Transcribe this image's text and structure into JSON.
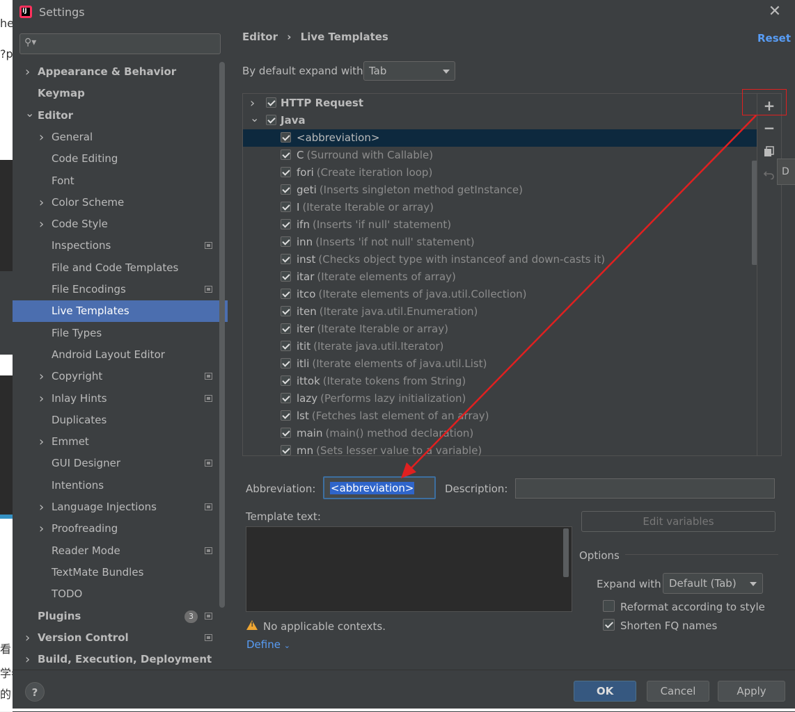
{
  "window": {
    "title": "Settings"
  },
  "background_fragments": [
    "he",
    "?p",
    "看",
    "学者",
    "的"
  ],
  "sidebar": {
    "search_placeholder": "",
    "items": [
      {
        "label": "Appearance & Behavior",
        "level": 0,
        "bold": true,
        "arrow": "right",
        "page_icon": false
      },
      {
        "label": "Keymap",
        "level": 0,
        "bold": true,
        "arrow": "none",
        "page_icon": false
      },
      {
        "label": "Editor",
        "level": 0,
        "bold": true,
        "arrow": "down",
        "page_icon": false
      },
      {
        "label": "General",
        "level": 1,
        "bold": false,
        "arrow": "right",
        "page_icon": false
      },
      {
        "label": "Code Editing",
        "level": 1,
        "bold": false,
        "arrow": "none",
        "page_icon": false
      },
      {
        "label": "Font",
        "level": 1,
        "bold": false,
        "arrow": "none",
        "page_icon": false
      },
      {
        "label": "Color Scheme",
        "level": 1,
        "bold": false,
        "arrow": "right",
        "page_icon": false
      },
      {
        "label": "Code Style",
        "level": 1,
        "bold": false,
        "arrow": "right",
        "page_icon": false
      },
      {
        "label": "Inspections",
        "level": 1,
        "bold": false,
        "arrow": "none",
        "page_icon": true
      },
      {
        "label": "File and Code Templates",
        "level": 1,
        "bold": false,
        "arrow": "none",
        "page_icon": false
      },
      {
        "label": "File Encodings",
        "level": 1,
        "bold": false,
        "arrow": "none",
        "page_icon": true
      },
      {
        "label": "Live Templates",
        "level": 1,
        "bold": false,
        "arrow": "none",
        "page_icon": false,
        "selected": true
      },
      {
        "label": "File Types",
        "level": 1,
        "bold": false,
        "arrow": "none",
        "page_icon": false
      },
      {
        "label": "Android Layout Editor",
        "level": 1,
        "bold": false,
        "arrow": "none",
        "page_icon": false
      },
      {
        "label": "Copyright",
        "level": 1,
        "bold": false,
        "arrow": "right",
        "page_icon": true
      },
      {
        "label": "Inlay Hints",
        "level": 1,
        "bold": false,
        "arrow": "right",
        "page_icon": true
      },
      {
        "label": "Duplicates",
        "level": 1,
        "bold": false,
        "arrow": "none",
        "page_icon": false
      },
      {
        "label": "Emmet",
        "level": 1,
        "bold": false,
        "arrow": "right",
        "page_icon": false
      },
      {
        "label": "GUI Designer",
        "level": 1,
        "bold": false,
        "arrow": "none",
        "page_icon": true
      },
      {
        "label": "Intentions",
        "level": 1,
        "bold": false,
        "arrow": "none",
        "page_icon": false
      },
      {
        "label": "Language Injections",
        "level": 1,
        "bold": false,
        "arrow": "right",
        "page_icon": true
      },
      {
        "label": "Proofreading",
        "level": 1,
        "bold": false,
        "arrow": "right",
        "page_icon": false
      },
      {
        "label": "Reader Mode",
        "level": 1,
        "bold": false,
        "arrow": "none",
        "page_icon": true
      },
      {
        "label": "TextMate Bundles",
        "level": 1,
        "bold": false,
        "arrow": "none",
        "page_icon": false
      },
      {
        "label": "TODO",
        "level": 1,
        "bold": false,
        "arrow": "none",
        "page_icon": false
      },
      {
        "label": "Plugins",
        "level": 0,
        "bold": true,
        "arrow": "none",
        "page_icon": true,
        "badge": "3"
      },
      {
        "label": "Version Control",
        "level": 0,
        "bold": true,
        "arrow": "right",
        "page_icon": true
      },
      {
        "label": "Build, Execution, Deployment",
        "level": 0,
        "bold": true,
        "arrow": "right",
        "page_icon": false
      }
    ]
  },
  "header": {
    "breadcrumb_parent": "Editor",
    "breadcrumb_sep": "›",
    "breadcrumb_current": "Live Templates",
    "reset_label": "Reset"
  },
  "expand": {
    "label": "By default expand with",
    "value": "Tab"
  },
  "tree": {
    "groups": [
      {
        "name": "HTTP Request",
        "expanded": false,
        "checked": true
      },
      {
        "name": "Java",
        "expanded": true,
        "checked": true
      }
    ],
    "items": [
      {
        "abbr": "<abbreviation>",
        "desc": "",
        "selected": true
      },
      {
        "abbr": "C",
        "desc": "(Surround with Callable)"
      },
      {
        "abbr": "fori",
        "desc": "(Create iteration loop)"
      },
      {
        "abbr": "geti",
        "desc": "(Inserts singleton method getInstance)"
      },
      {
        "abbr": "I",
        "desc": "(Iterate Iterable or array)"
      },
      {
        "abbr": "ifn",
        "desc": "(Inserts 'if null' statement)"
      },
      {
        "abbr": "inn",
        "desc": "(Inserts 'if not null' statement)"
      },
      {
        "abbr": "inst",
        "desc": "(Checks object type with instanceof and down-casts it)"
      },
      {
        "abbr": "itar",
        "desc": "(Iterate elements of array)"
      },
      {
        "abbr": "itco",
        "desc": "(Iterate elements of java.util.Collection)"
      },
      {
        "abbr": "iten",
        "desc": "(Iterate java.util.Enumeration)"
      },
      {
        "abbr": "iter",
        "desc": "(Iterate Iterable or array)"
      },
      {
        "abbr": "itit",
        "desc": "(Iterate java.util.Iterator)"
      },
      {
        "abbr": "itli",
        "desc": "(Iterate elements of java.util.List)"
      },
      {
        "abbr": "ittok",
        "desc": "(Iterate tokens from String)"
      },
      {
        "abbr": "lazy",
        "desc": "(Performs lazy initialization)"
      },
      {
        "abbr": "lst",
        "desc": "(Fetches last element of an array)"
      },
      {
        "abbr": "main",
        "desc": "(main() method declaration)"
      },
      {
        "abbr": "mn",
        "desc": "(Sets lesser value to a variable)"
      }
    ]
  },
  "toolbar": {
    "add": "+",
    "remove": "−",
    "copy_icon": "copy-icon",
    "restore_icon": "undo-icon",
    "tooltip": "D"
  },
  "editor": {
    "abbr_label": "Abbreviation:",
    "abbr_value": "<abbreviation>",
    "desc_label": "Description:",
    "desc_value": "",
    "template_label": "Template text:",
    "template_value": "",
    "edit_vars_label": "Edit variables",
    "options_label": "Options",
    "expand_with_label": "Expand with",
    "expand_with_value": "Default (Tab)",
    "reformat_label": "Reformat according to style",
    "reformat_checked": false,
    "shorten_label": "Shorten FQ names",
    "shorten_checked": true,
    "warning_text": "No applicable contexts.",
    "define_label": "Define"
  },
  "footer": {
    "help": "?",
    "ok": "OK",
    "cancel": "Cancel",
    "apply": "Apply"
  },
  "colors": {
    "accent": "#4b6eaf",
    "link": "#589df6",
    "annotation": "#e02020",
    "bg": "#3c3f41"
  }
}
